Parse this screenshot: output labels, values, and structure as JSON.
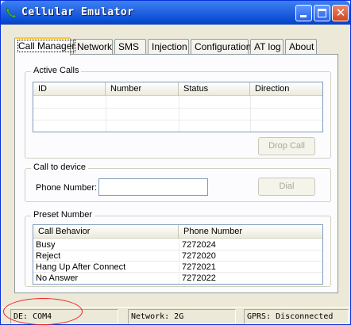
{
  "window": {
    "title": "Cellular Emulator"
  },
  "tabs": [
    {
      "label": "Call Manager"
    },
    {
      "label": "Network"
    },
    {
      "label": "SMS"
    },
    {
      "label": "Injection"
    },
    {
      "label": "Configuration"
    },
    {
      "label": "AT log"
    },
    {
      "label": "About"
    }
  ],
  "active_calls": {
    "title": "Active Calls",
    "columns": [
      "ID",
      "Number",
      "Status",
      "Direction"
    ],
    "drop_label": "Drop Call"
  },
  "call_to_device": {
    "title": "Call to device",
    "phone_label": "Phone Number:",
    "phone_value": "",
    "dial_label": "Dial"
  },
  "preset": {
    "title": "Preset Number",
    "columns": [
      "Call Behavior",
      "Phone Number"
    ],
    "rows": [
      {
        "behavior": "Busy",
        "number": "7272024"
      },
      {
        "behavior": "Reject",
        "number": "7272020"
      },
      {
        "behavior": "Hang Up After Connect",
        "number": "7272021"
      },
      {
        "behavior": "No Answer",
        "number": "7272022"
      }
    ]
  },
  "status": {
    "device": "DE: COM4",
    "network": "Network: 2G",
    "gprs": "GPRS: Disconnected"
  },
  "colors": {
    "title_bar": "#0a4fd6",
    "annotation": "#e22222"
  }
}
